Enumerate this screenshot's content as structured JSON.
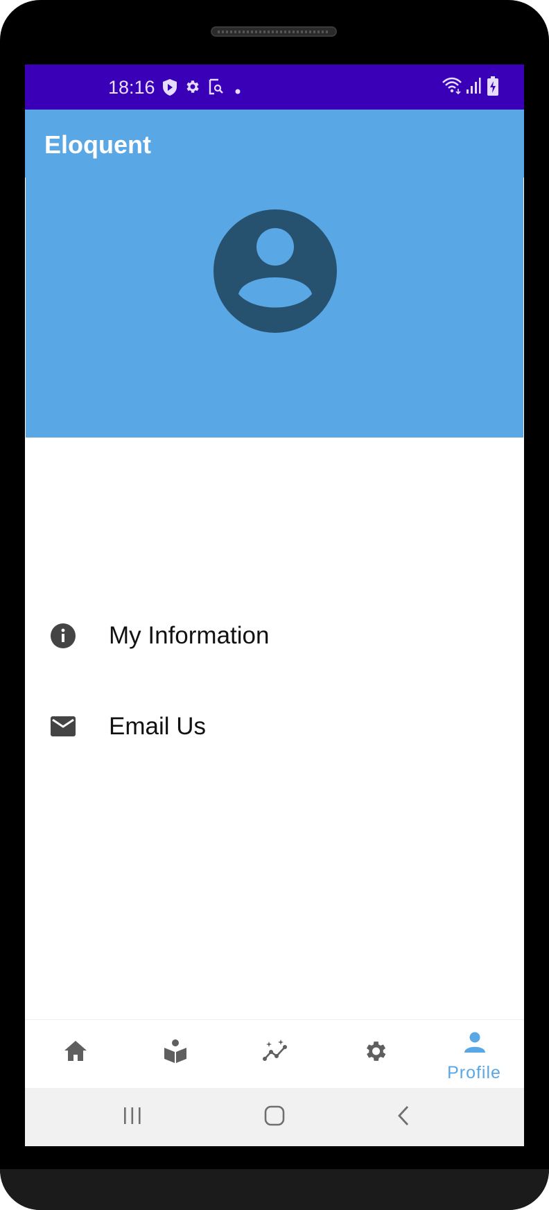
{
  "status_bar": {
    "time": "18:16",
    "left_icons": [
      "shield-play-icon",
      "gear-icon",
      "screenshot-search-icon",
      "dot-icon"
    ],
    "right_icons": [
      "wifi-icon",
      "signal-icon",
      "battery-charging-icon"
    ],
    "background": "#3a00b8"
  },
  "app_bar": {
    "title": "Eloquent",
    "background": "#5aa7e5"
  },
  "profile_header": {
    "avatar_icon": "account-circle-icon",
    "avatar_color": "#26526f"
  },
  "menu": {
    "items": [
      {
        "icon": "info-icon",
        "label": "My Information"
      },
      {
        "icon": "mail-icon",
        "label": "Email Us"
      }
    ]
  },
  "bottom_nav": {
    "items": [
      {
        "icon": "home-icon",
        "label": "",
        "active": false
      },
      {
        "icon": "book-reader-icon",
        "label": "",
        "active": false
      },
      {
        "icon": "insights-icon",
        "label": "",
        "active": false
      },
      {
        "icon": "gear-icon",
        "label": "",
        "active": false
      },
      {
        "icon": "person-icon",
        "label": "Profile",
        "active": true
      }
    ],
    "active_color": "#5aa7e5",
    "inactive_color": "#5f5f5f"
  },
  "system_nav": {
    "buttons": [
      "recent-apps-icon",
      "home-button-icon",
      "back-icon"
    ]
  }
}
